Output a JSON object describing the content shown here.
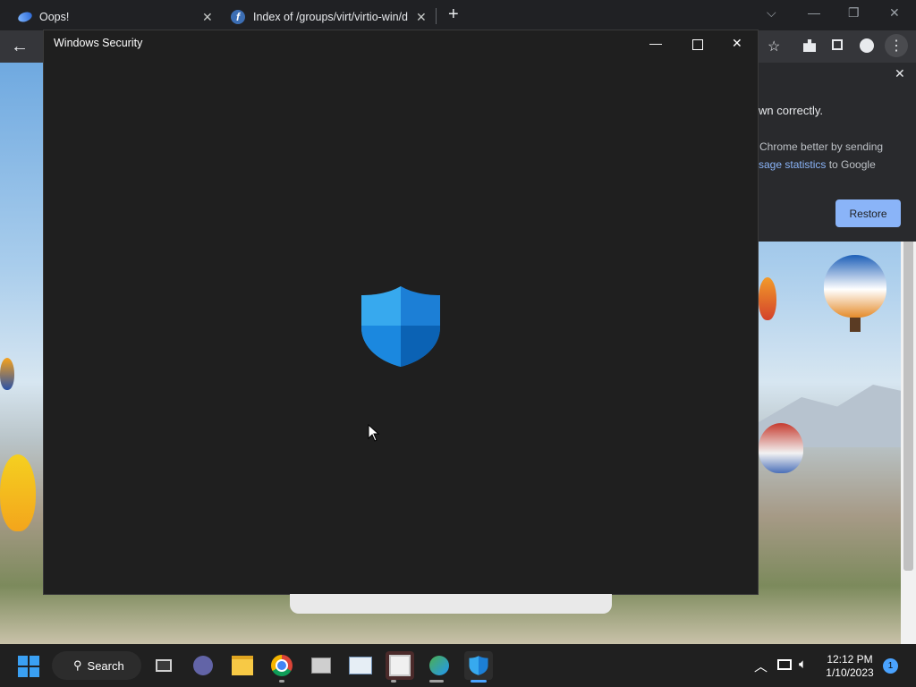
{
  "browser": {
    "tabs": [
      {
        "title": "Oops!"
      },
      {
        "title": "Index of /groups/virt/virtio-win/d"
      }
    ],
    "new_tab_glyph": "+"
  },
  "restore_popup": {
    "heading_fragment": "wn correctly.",
    "text_line1": "Chrome better by sending",
    "link_text": "sage statistics",
    "text_line2_suffix": " to Google",
    "restore_label": "Restore"
  },
  "security_window": {
    "title": "Windows Security"
  },
  "taskbar": {
    "search_label": "Search",
    "time": "12:12 PM",
    "date": "1/10/2023",
    "notification_count": "1"
  },
  "colors": {
    "shield_light": "#37a9ee",
    "shield_dark": "#0b62b4",
    "accent": "#8ab4f8"
  }
}
